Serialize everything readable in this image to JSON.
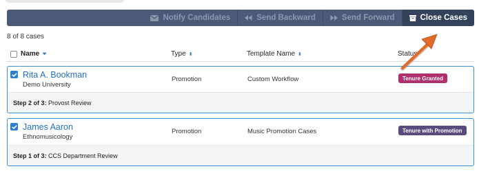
{
  "toolbar": {
    "notify_label": "Notify Candidates",
    "send_backward_label": "Send Backward",
    "send_forward_label": "Send Forward",
    "close_cases_label": "Close Cases"
  },
  "case_count": "8 of 8 cases",
  "columns": {
    "name": "Name",
    "type": "Type",
    "template": "Template Name",
    "status": "Status"
  },
  "cases": [
    {
      "name": "Rita A. Bookman",
      "sub": "Demo University",
      "type": "Promotion",
      "template": "Custom Workflow",
      "status": "Tenure Granted",
      "step_prefix": "Step 2 of 3:",
      "step_name": "Provost Review"
    },
    {
      "name": "James Aaron",
      "sub": "Ethnomusicology",
      "type": "Promotion",
      "template": "Music Promotion Cases",
      "status": "Tenure with Promotion",
      "step_prefix": "Step 1 of 3:",
      "step_name": "CCS Department Review"
    }
  ],
  "colors": {
    "toolbar_bg": "#4a5a78",
    "toolbar_active_bg": "#34425c",
    "accent_blue": "#2a7fcf",
    "badge_tenure_granted": "#b0306e",
    "badge_tenure_promotion": "#5a4a7e",
    "annotation_arrow": "#e06a2a"
  },
  "icons": {
    "notify": "envelope-icon",
    "send_backward": "rewind-icon",
    "send_forward": "fast-forward-icon",
    "close_cases": "archive-box-icon"
  }
}
